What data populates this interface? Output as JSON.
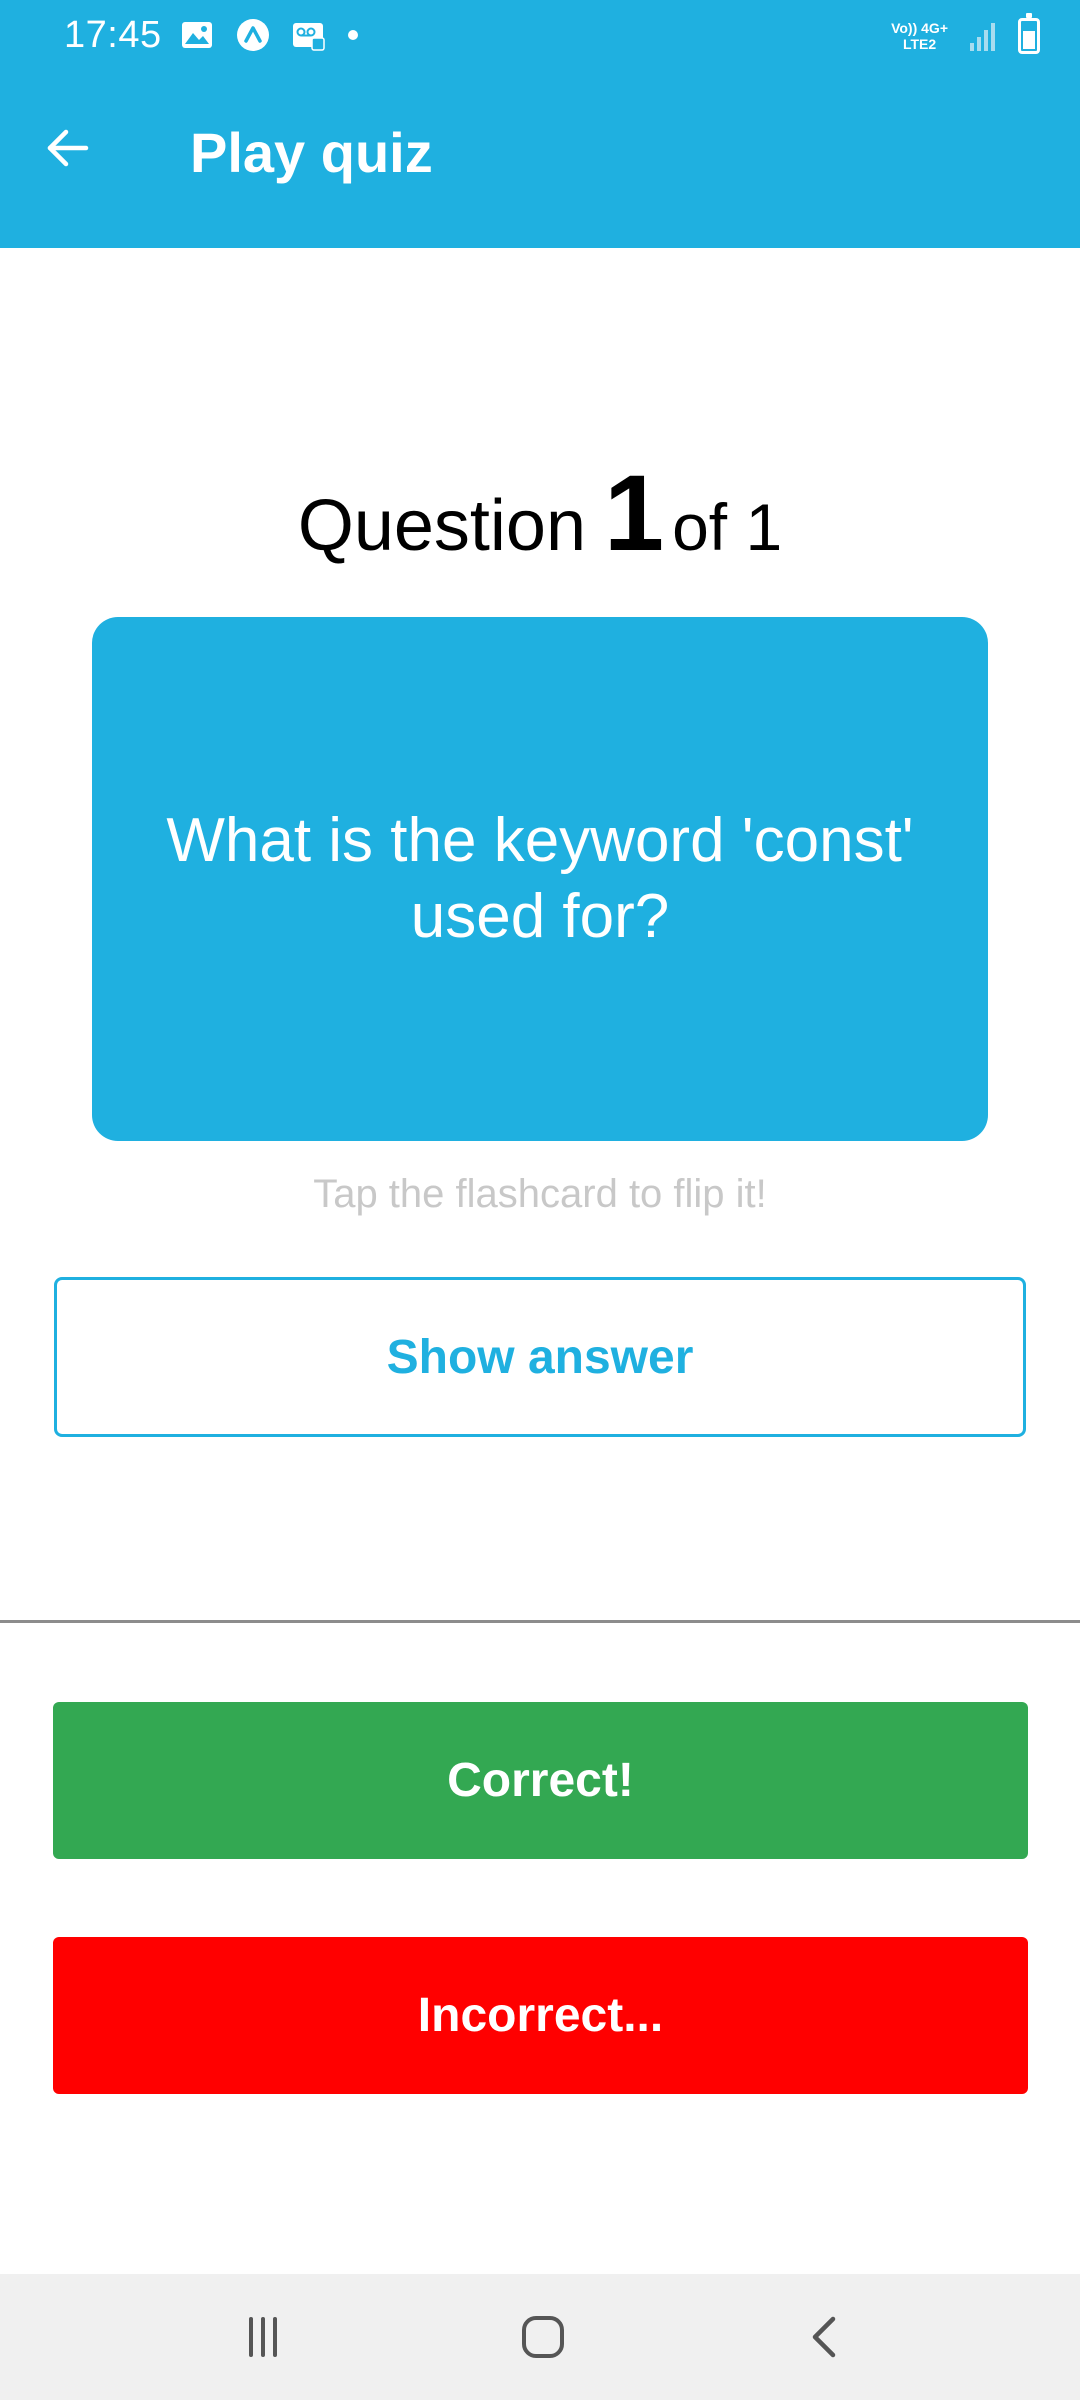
{
  "status_bar": {
    "time": "17:45",
    "network_line1": "Vo)) 4G+",
    "network_line2": "LTE2",
    "battery_level": 0.75,
    "icons": [
      "image-icon",
      "app-icon",
      "voicemail-icon",
      "dot-icon",
      "signal-icon",
      "battery-icon"
    ]
  },
  "app_bar": {
    "title": "Play quiz",
    "back_icon": "arrow-left-icon"
  },
  "counter": {
    "label": "Question",
    "current": "1",
    "of_text": "of 1"
  },
  "flashcard": {
    "question": "What is the keyword 'const' used for?"
  },
  "hint": "Tap the flashcard to flip it!",
  "show_answer_label": "Show answer",
  "correct_label": "Correct!",
  "incorrect_label": "Incorrect...",
  "colors": {
    "primary": "#1fb0e0",
    "correct": "#33a852",
    "incorrect": "#ff0000",
    "hint": "#c8c8c8"
  },
  "nav_bar": {
    "icons": [
      "recents-icon",
      "home-icon",
      "back-icon"
    ]
  }
}
